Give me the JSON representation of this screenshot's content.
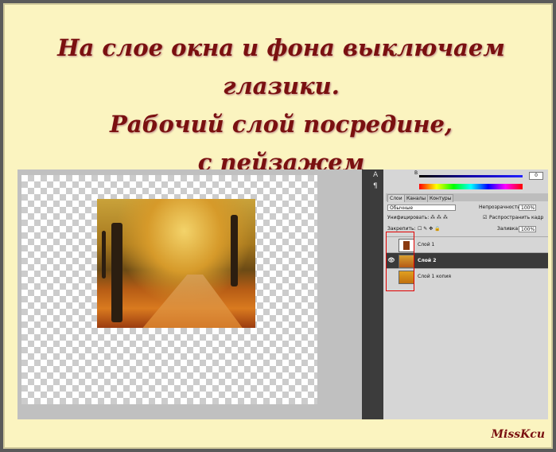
{
  "title": {
    "line1": "На слое окна и фона выключаем глазики.",
    "line2": "Рабочий слой посредине,",
    "line3": "с пейзажем"
  },
  "signature": "MissKcu",
  "panel": {
    "color_value": "0",
    "tabs": [
      "Слои",
      "Каналы",
      "Контуры"
    ],
    "blend_mode": "Обычные",
    "opacity_label": "Непрозрачность:",
    "opacity_value": "100%",
    "unify_label": "Унифицировать:",
    "propagate_label": "Распространить кадр",
    "lock_label": "Закрепить:",
    "fill_label": "Заливка:",
    "fill_value": "100%",
    "layers": [
      {
        "name": "Слой 1",
        "visible": false,
        "selected": false
      },
      {
        "name": "Слой 2",
        "visible": true,
        "selected": true
      },
      {
        "name": "Слой 1 копия",
        "visible": false,
        "selected": false
      }
    ]
  },
  "icons": [
    "type-tool-icon",
    "paragraph-icon",
    "eye-icon",
    "checkbox-icon"
  ],
  "colors": {
    "title": "#7a1010",
    "background": "#fbf4c0",
    "highlight_box": "#e00000"
  }
}
